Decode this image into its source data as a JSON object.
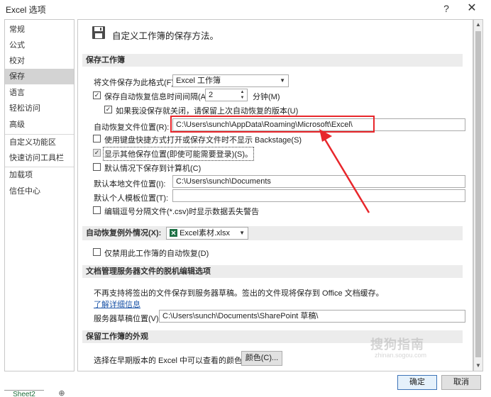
{
  "window": {
    "title": "Excel 选项",
    "help": "?",
    "close": "✕"
  },
  "sidebar": {
    "items": [
      {
        "label": "常规"
      },
      {
        "label": "公式"
      },
      {
        "label": "校对"
      },
      {
        "label": "保存"
      },
      {
        "label": "语言"
      },
      {
        "label": "轻松访问"
      },
      {
        "label": "高级"
      },
      {
        "label": "自定义功能区"
      },
      {
        "label": "快速访问工具栏"
      },
      {
        "label": "加载项"
      },
      {
        "label": "信任中心"
      }
    ],
    "active": "保存"
  },
  "header": {
    "text": "自定义工作簿的保存方法。"
  },
  "save_section": {
    "title": "保存工作簿",
    "format_label": "将文件保存为此格式(F):",
    "format_value": "Excel 工作簿",
    "autorecover_label": "保存自动恢复信息时间间隔(A)",
    "autorecover_value": "2",
    "minutes_label": "分钟(M)",
    "keep_last_label": "如果我没保存就关闭，请保留上次自动恢复的版本(U)",
    "autorecover_location_label": "自动恢复文件位置(R):",
    "autorecover_location_value": "C:\\Users\\sunch\\AppData\\Roaming\\Microsoft\\Excel\\",
    "no_backstage_label": "使用键盘快捷方式打开或保存文件时不显示 Backstage(S)",
    "show_other_locations_label": "显示其他保存位置(即使可能需要登录)(S)。",
    "save_to_computer_label": "默认情况下保存到计算机(C)",
    "default_local_label": "默认本地文件位置(I):",
    "default_local_value": "C:\\Users\\sunch\\Documents",
    "default_template_label": "默认个人模板位置(T):",
    "default_template_value": "",
    "csv_warning_label": "编辑逗号分隔文件(*.csv)时显示数据丢失警告"
  },
  "autorecover_exceptions": {
    "title": "自动恢复例外情况(X):",
    "workbook": "Excel素材.xlsx",
    "disable_label": "仅禁用此工作簿的自动恢复(D)"
  },
  "offline_editing": {
    "title": "文档管理服务器文件的脱机编辑选项",
    "notice": "不再支持将签出的文件保存到服务器草稿。签出的文件现将保存到 Office 文档缓存。",
    "learn_more": "了解详细信息",
    "drafts_label": "服务器草稿位置(V):",
    "drafts_value": "C:\\Users\\sunch\\Documents\\SharePoint 草稿\\"
  },
  "appearance": {
    "title": "保留工作簿的外观",
    "colors_label": "选择在早期版本的 Excel 中可以查看的颜色:",
    "colors_button": "颜色(C)..."
  },
  "footer": {
    "ok": "确定",
    "cancel": "取消",
    "sheet_tab": "Sheet2",
    "add_sheet": "⊕"
  },
  "watermark": {
    "text": "搜狗指南",
    "sub": "zhinan.sogou.com"
  },
  "colors": {
    "highlight": "#e8262b",
    "active_nav": "#d3d3d3",
    "section_bg": "#ececec"
  }
}
